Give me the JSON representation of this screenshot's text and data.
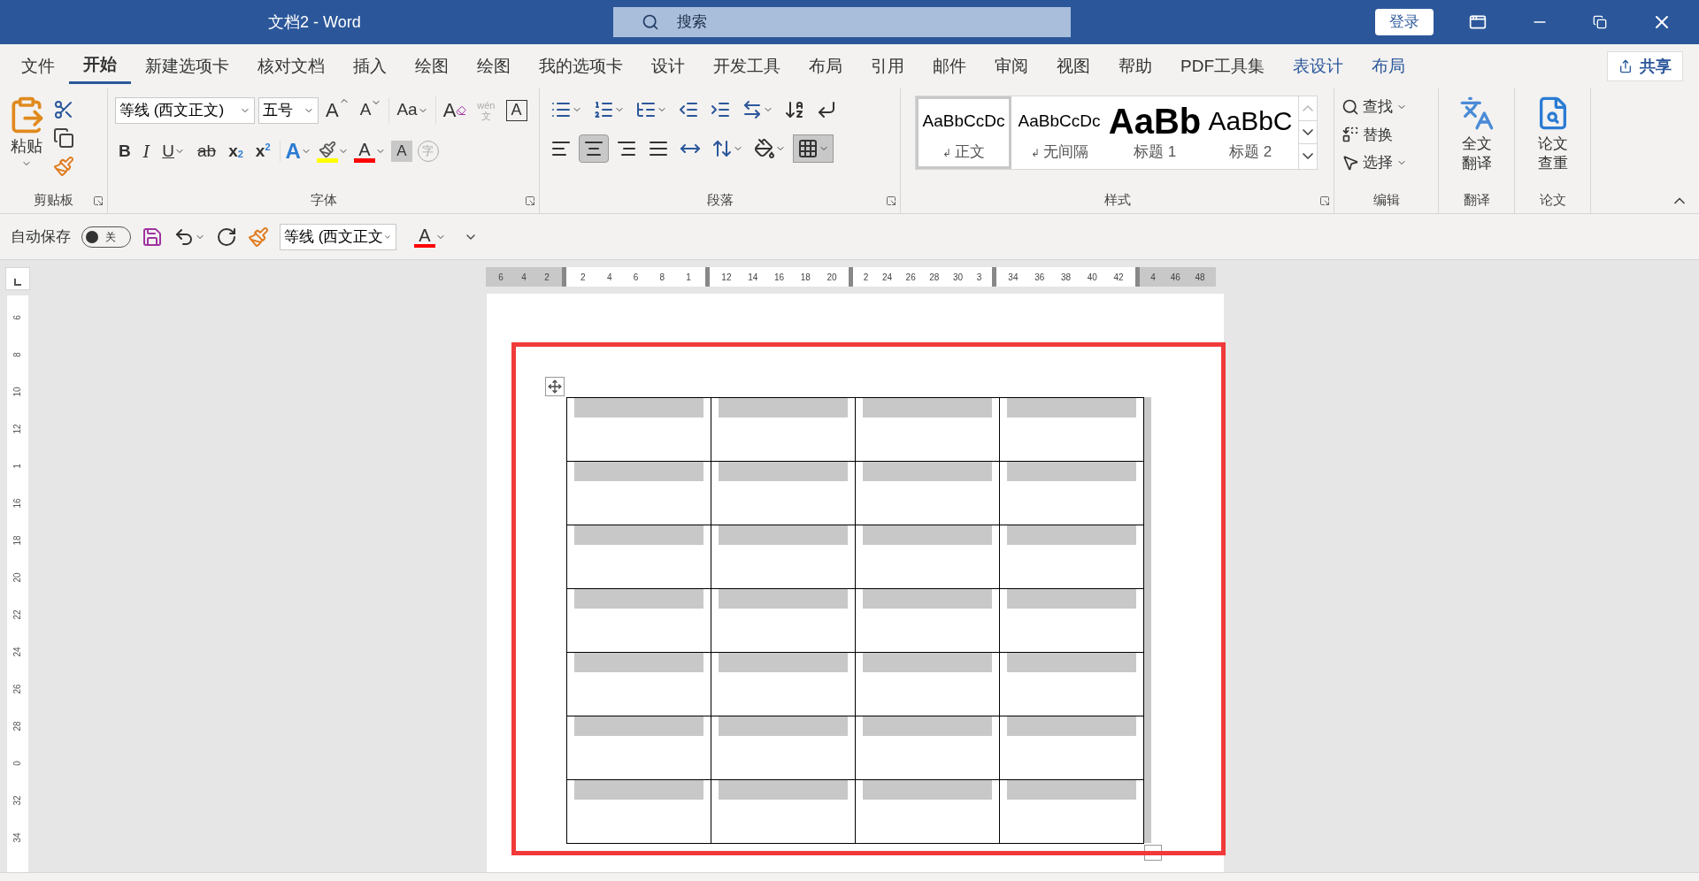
{
  "window": {
    "title": "文档2 - Word",
    "search_placeholder": "搜索",
    "login": "登录"
  },
  "tabs": [
    {
      "label": "文件",
      "selected": false,
      "kind": "normal"
    },
    {
      "label": "开始",
      "selected": true,
      "kind": "normal"
    },
    {
      "label": "新建选项卡",
      "selected": false,
      "kind": "normal"
    },
    {
      "label": "核对文档",
      "selected": false,
      "kind": "normal"
    },
    {
      "label": "插入",
      "selected": false,
      "kind": "normal"
    },
    {
      "label": "绘图",
      "selected": false,
      "kind": "normal"
    },
    {
      "label": "绘图",
      "selected": false,
      "kind": "normal"
    },
    {
      "label": "我的选项卡",
      "selected": false,
      "kind": "normal"
    },
    {
      "label": "设计",
      "selected": false,
      "kind": "normal"
    },
    {
      "label": "开发工具",
      "selected": false,
      "kind": "normal"
    },
    {
      "label": "布局",
      "selected": false,
      "kind": "normal"
    },
    {
      "label": "引用",
      "selected": false,
      "kind": "normal"
    },
    {
      "label": "邮件",
      "selected": false,
      "kind": "normal"
    },
    {
      "label": "审阅",
      "selected": false,
      "kind": "normal"
    },
    {
      "label": "视图",
      "selected": false,
      "kind": "normal"
    },
    {
      "label": "帮助",
      "selected": false,
      "kind": "normal"
    },
    {
      "label": "PDF工具集",
      "selected": false,
      "kind": "normal"
    },
    {
      "label": "表设计",
      "selected": false,
      "kind": "contextual"
    },
    {
      "label": "布局",
      "selected": false,
      "kind": "contextual"
    }
  ],
  "share": "共享",
  "ribbon": {
    "clipboard": {
      "label": "剪贴板",
      "paste": "粘贴"
    },
    "font": {
      "label": "字体",
      "font_name": "等线 (西文正文)",
      "font_size": "五号",
      "grow": "A",
      "shrink": "A",
      "change_case": "Aa",
      "clear": "A",
      "phonetic_top": "wén",
      "phonetic_bottom": "文",
      "border_char": "A",
      "format_buttons": [
        {
          "kind": "bold",
          "glyph": "B"
        },
        {
          "kind": "italic",
          "glyph": "I"
        },
        {
          "kind": "underline",
          "glyph": "U"
        },
        {
          "kind": "strike",
          "glyph": "ab"
        },
        {
          "kind": "subscript",
          "glyph": "x",
          "index": "2"
        },
        {
          "kind": "superscript",
          "glyph": "x",
          "index": "2"
        }
      ],
      "effect_buttons": [
        {
          "kind": "effect",
          "glyph": "A",
          "color": "#2b7cd3"
        },
        {
          "kind": "highlight",
          "color": "#ffff00"
        },
        {
          "kind": "fontcolor",
          "glyph": "A",
          "color": "#ff0000"
        },
        {
          "kind": "shading",
          "glyph": "A"
        },
        {
          "kind": "enclose",
          "glyph": "字"
        }
      ]
    },
    "paragraph": {
      "label": "段落",
      "alignments": [
        {
          "kind": "left",
          "selected": false
        },
        {
          "kind": "center",
          "selected": true
        },
        {
          "kind": "right",
          "selected": false
        },
        {
          "kind": "justify",
          "selected": false
        },
        {
          "kind": "distributed",
          "selected": false
        }
      ]
    },
    "styles": {
      "label": "样式",
      "items": [
        {
          "preview": "AaBbCcDc",
          "name": "正文",
          "kind": "body",
          "selected": true,
          "mark": "↲"
        },
        {
          "preview": "AaBbCcDc",
          "name": "无间隔",
          "kind": "body",
          "selected": false,
          "mark": "↲"
        },
        {
          "preview": "AaBb",
          "name": "标题 1",
          "kind": "heading1",
          "selected": false
        },
        {
          "preview": "AaBbC",
          "name": "标题 2",
          "kind": "heading2",
          "selected": false
        }
      ]
    },
    "editing": {
      "label": "编辑",
      "items": [
        {
          "label": "查找",
          "kind": "find"
        },
        {
          "label": "替换",
          "kind": "replace"
        },
        {
          "label": "选择",
          "kind": "select"
        }
      ]
    },
    "translate": {
      "label": "翻译",
      "button": [
        "全文",
        "翻译"
      ]
    },
    "paper": {
      "label": "论文",
      "button": [
        "论文",
        "查重"
      ]
    }
  },
  "quick_access": {
    "autosave": "自动保存",
    "autosave_on": false,
    "autosave_state": "关",
    "font_name": "等线 (西文正文",
    "font_color": "A"
  },
  "ruler": {
    "horizontal": [
      {
        "kind": "margin",
        "labels": [
          "6",
          "4",
          "2"
        ]
      },
      {
        "kind": "column",
        "labels": [
          "2",
          "4",
          "6",
          "8",
          "1"
        ]
      },
      {
        "kind": "column",
        "labels": [
          "12",
          "14",
          "16",
          "18",
          "20"
        ]
      },
      {
        "kind": "column",
        "labels": [
          "2",
          "24",
          "26",
          "28",
          "30",
          "3"
        ]
      },
      {
        "kind": "column",
        "labels": [
          "34",
          "36",
          "38",
          "40",
          "42"
        ]
      },
      {
        "kind": "margin",
        "labels": [
          "4",
          "46",
          "48"
        ]
      }
    ],
    "vertical": [
      "6",
      "8",
      "10",
      "12",
      "1",
      "16",
      "18",
      "20",
      "22",
      "24",
      "26",
      "28",
      "0",
      "32",
      "34"
    ]
  },
  "table": {
    "rows": [
      {
        "cells": [
          {
            "shaded": true
          },
          {
            "shaded": true
          },
          {
            "shaded": true
          },
          {
            "shaded": true
          }
        ]
      },
      {
        "cells": [
          {
            "shaded": true
          },
          {
            "shaded": true
          },
          {
            "shaded": true
          },
          {
            "shaded": true
          }
        ]
      },
      {
        "cells": [
          {
            "shaded": true
          },
          {
            "shaded": true
          },
          {
            "shaded": true
          },
          {
            "shaded": true
          }
        ]
      },
      {
        "cells": [
          {
            "shaded": true
          },
          {
            "shaded": true
          },
          {
            "shaded": true
          },
          {
            "shaded": true
          }
        ]
      },
      {
        "cells": [
          {
            "shaded": true
          },
          {
            "shaded": true
          },
          {
            "shaded": true
          },
          {
            "shaded": true
          }
        ]
      },
      {
        "cells": [
          {
            "shaded": true
          },
          {
            "shaded": true
          },
          {
            "shaded": true
          },
          {
            "shaded": true
          }
        ]
      },
      {
        "cells": [
          {
            "shaded": true
          },
          {
            "shaded": true
          },
          {
            "shaded": true
          },
          {
            "shaded": true
          }
        ]
      }
    ]
  },
  "annotation": {
    "kind": "rectangle",
    "color": "#f03a3a"
  }
}
